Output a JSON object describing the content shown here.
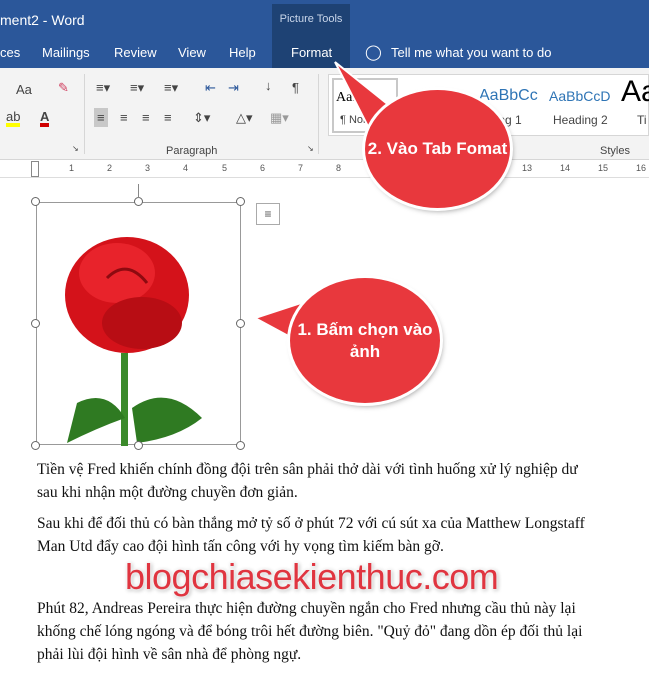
{
  "window": {
    "title": "ment2  -  Word",
    "context_group": "Picture Tools"
  },
  "tabs": [
    {
      "label": "ces"
    },
    {
      "label": "Mailings"
    },
    {
      "label": "Review"
    },
    {
      "label": "View"
    },
    {
      "label": "Help"
    },
    {
      "label": "Format",
      "active": true
    }
  ],
  "tell_me": "Tell me what you want to do",
  "ribbon": {
    "font_case": "Aa",
    "paragraph_group": "Paragraph",
    "styles_group": "Styles",
    "styles": [
      {
        "preview": "AaI",
        "label": "¶ Norı"
      },
      {
        "preview": "AaBbCc",
        "label": "ding 1"
      },
      {
        "preview": "AaBbCcD",
        "label": "Heading 2"
      },
      {
        "preview": "Aa",
        "label": "Ti"
      }
    ]
  },
  "ruler": [
    "1",
    "2",
    "3",
    "4",
    "5",
    "6",
    "7",
    "8",
    "13",
    "14",
    "15",
    "16"
  ],
  "callouts": {
    "select_image": "1. Bấm chọn vào ảnh",
    "format_tab": "2. Vào Tab Fomat"
  },
  "document": {
    "paragraphs": [
      [
        "Tiền vệ Fred khiến chính đồng đội trên sân phải thở dài với tình huống xử lý nghiệp dư",
        "sau khi nhận một đường chuyền đơn giản."
      ],
      [
        "Sau khi để đối thủ có bàn thắng mở tỷ số ở phút 72 với cú sút xa của Matthew Longstaff",
        "Man Utd đẩy cao đội hình tấn công với hy vọng tìm kiếm bàn gỡ."
      ],
      [
        "Phút 82, Andreas Pereira thực hiện đường chuyền ngắn cho Fred nhưng cầu thủ này lại",
        "khống chế lóng ngóng và để bóng trôi hết đường biên. \"Quỷ đỏ\" đang dồn ép đối thủ lại",
        "phải lùi đội hình về sân nhà để phòng ngự."
      ]
    ]
  },
  "watermark": "blogchiasekienthuc.com",
  "colors": {
    "word_blue": "#2b579a",
    "callout_red": "#e8383d",
    "highlight": "#ffff00",
    "font_color": "#d00000"
  }
}
